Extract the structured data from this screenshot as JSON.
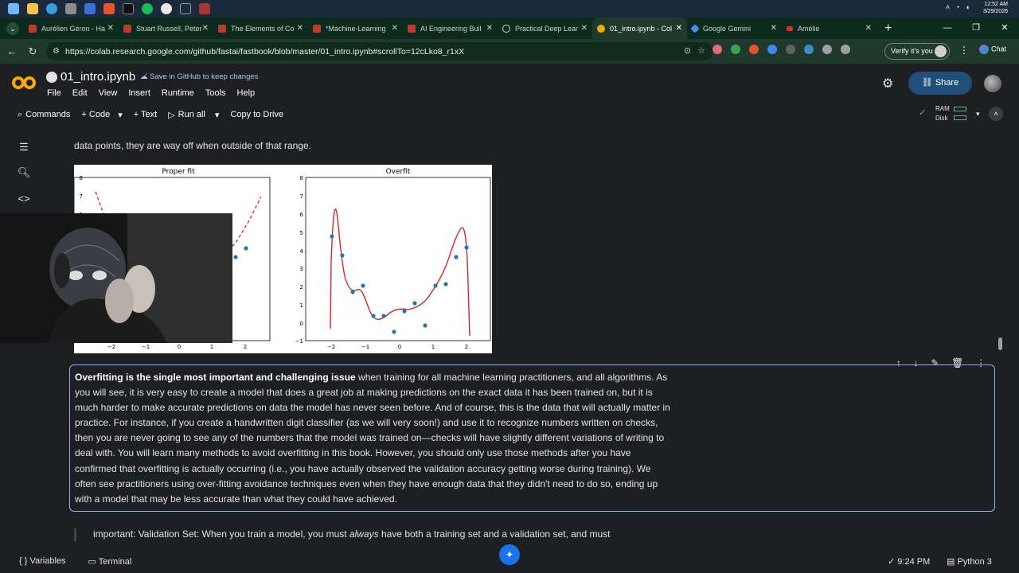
{
  "os_taskbar": {
    "time": "12:52 AM",
    "date": "3/29/2026"
  },
  "browser": {
    "tabs": [
      {
        "label": "Aurélien Géron - Ha"
      },
      {
        "label": "Stuart Russell, Peter"
      },
      {
        "label": "The Elements of Co"
      },
      {
        "label": "*Machine-Learning"
      },
      {
        "label": "AI Engineering Buil"
      },
      {
        "label": "Practical Deep Lear"
      },
      {
        "label": "01_intro.ipynb - Col",
        "active": true
      },
      {
        "label": "Google Gemini"
      },
      {
        "label": "Amélie"
      }
    ],
    "url": "https://colab.research.google.com/github/fastai/fastbook/blob/master/01_intro.ipynb#scrollTo=12cLko8_r1xX",
    "verify_label": "Verify it's you",
    "chat_label": "Chat"
  },
  "colab": {
    "notebook_name": "01_intro.ipynb",
    "save_label": "Save in GitHub to keep changes",
    "menu": [
      "File",
      "Edit",
      "View",
      "Insert",
      "Runtime",
      "Tools",
      "Help"
    ],
    "share_label": "Share",
    "toolbar": {
      "commands": "Commands",
      "code": "+ Code",
      "text": "+ Text",
      "run_all": "Run all",
      "copy": "Copy to Drive"
    },
    "resources": {
      "ram": "RAM",
      "disk": "Disk"
    }
  },
  "notebook": {
    "prev_text": "data points, they are way off when outside of that range.",
    "figure": {
      "left_title": "Proper fit",
      "right_title": "Overfit",
      "y_ticks": [
        "8",
        "7",
        "6",
        "5",
        "4",
        "3",
        "2",
        "1",
        "0",
        "−1"
      ],
      "x_ticks": [
        "−2",
        "−1",
        "0",
        "1",
        "2"
      ]
    },
    "markdown": {
      "bold": "Overfitting is the single most important and challenging issue",
      "rest": " when training for all machine learning practitioners, and all algorithms. As you will see, it is very easy to create a model that does a great job at making predictions on the exact data it has been trained on, but it is much harder to make accurate predictions on data the model has never seen before. And of course, this is the data that will actually matter in practice. For instance, if you create a handwritten digit classifier (as we will very soon!) and use it to recognize numbers written on checks, then you are never going to see any of the numbers that the model was trained on—checks will have slightly different variations of writing to deal with. You will learn many methods to avoid overfitting in this book. However, you should only use those methods after you have confirmed that overfitting is actually occurring (i.e., you have actually observed the validation accuracy getting worse during training). We often see practitioners using over-fitting avoidance techniques even when they have enough data that they didn't need to do so, ending up with a model that may be less accurate than what they could have achieved."
    },
    "quote": {
      "before": "important: Validation Set: When you train a model, you must ",
      "em": "always",
      "after": " have both a training set and a validation set, and must"
    }
  },
  "statusbar": {
    "variables": "Variables",
    "terminal": "Terminal",
    "time": "9:24 PM",
    "runtime": "Python 3"
  },
  "colors": {
    "accent": "#8ab4f8",
    "chrome_green": "#1f3a2c",
    "bg": "#1e1f22"
  }
}
